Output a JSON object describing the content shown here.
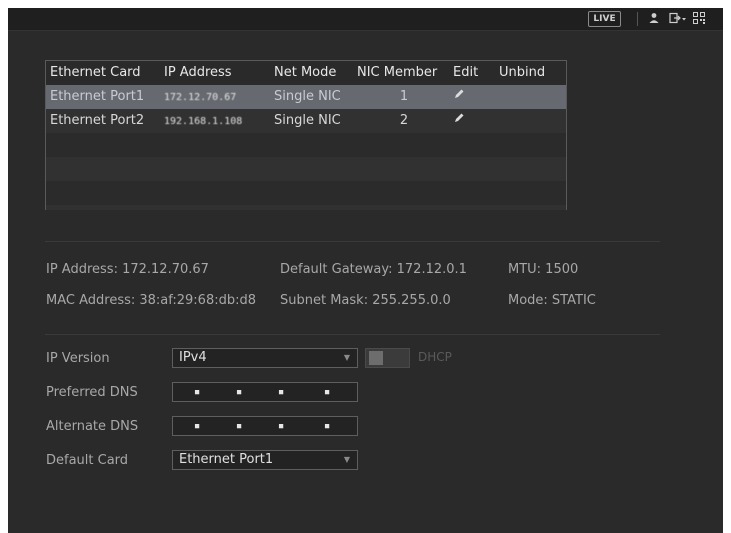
{
  "topbar": {
    "live_label": "LIVE",
    "icons": [
      "user-icon",
      "logout-icon",
      "qr-code-icon"
    ]
  },
  "table": {
    "headers": [
      "Ethernet Card",
      "IP Address",
      "Net Mode",
      "NIC Member",
      "Edit",
      "Unbind"
    ],
    "rows": [
      {
        "card": "Ethernet Port1",
        "ip": "172.12.70.67",
        "mode": "Single NIC",
        "member": "1"
      },
      {
        "card": "Ethernet Port2",
        "ip": "192.168.1.108",
        "mode": "Single NIC",
        "member": "2"
      }
    ]
  },
  "info": {
    "ip_address": "IP Address: 172.12.70.67",
    "default_gateway": "Default Gateway: 172.12.0.1",
    "mtu": "MTU: 1500",
    "mac_address": "MAC Address: 38:af:29:68:db:d8",
    "subnet_mask": "Subnet Mask: 255.255.0.0",
    "mode": "Mode: STATIC"
  },
  "form": {
    "ip_version_label": "IP Version",
    "ip_version_value": "IPv4",
    "dhcp_label": "DHCP",
    "dhcp_enabled": false,
    "preferred_dns_label": "Preferred DNS",
    "alternate_dns_label": "Alternate DNS",
    "default_card_label": "Default Card",
    "default_card_value": "Ethernet Port1"
  }
}
